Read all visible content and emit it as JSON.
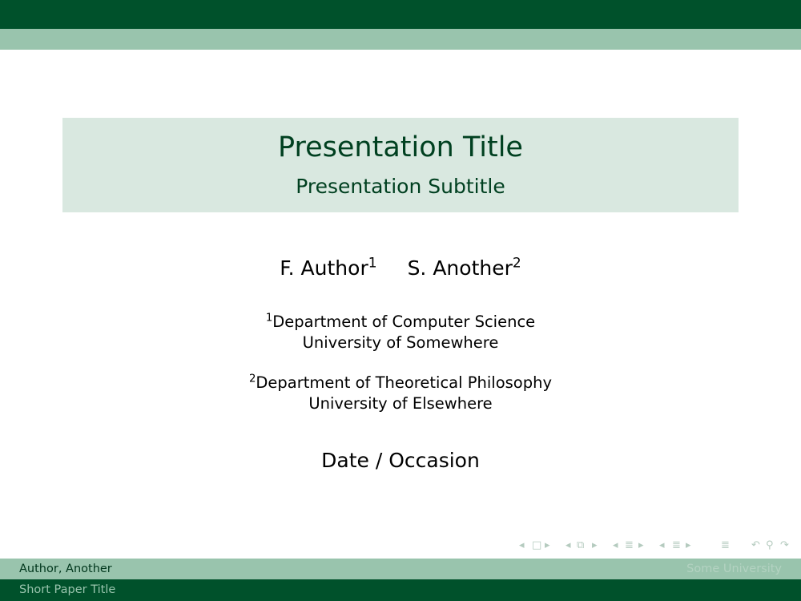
{
  "slide": {
    "title": "Presentation Title",
    "subtitle": "Presentation Subtitle",
    "authors": [
      {
        "name": "F. Author",
        "mark": "1"
      },
      {
        "name": "S. Another",
        "mark": "2"
      }
    ],
    "affiliations": [
      {
        "mark": "1",
        "department": "Department of Computer Science",
        "institution": "University of Somewhere"
      },
      {
        "mark": "2",
        "department": "Department of Theoretical Philosophy",
        "institution": "University of Elsewhere"
      }
    ],
    "date": "Date / Occasion"
  },
  "footer": {
    "author_short": "Author, Another",
    "institute_short": "Some University",
    "title_short": "Short Paper Title"
  },
  "navigation": {
    "icons": [
      "nav-prev-arrow",
      "frame-icon",
      "nav-next-arrow",
      "nav-prev-arrow",
      "subsection-icon",
      "nav-next-arrow",
      "nav-prev-arrow",
      "section-icon",
      "nav-next-arrow",
      "nav-prev-arrow",
      "section-icon",
      "nav-next-arrow",
      "appendix-icon",
      "undo-icon",
      "search-icon",
      "redo-icon"
    ]
  },
  "colors": {
    "primary_dark": "#00512b",
    "primary_light": "#99c4ad",
    "title_box": "#d9e8e0",
    "title_text": "#004020"
  }
}
